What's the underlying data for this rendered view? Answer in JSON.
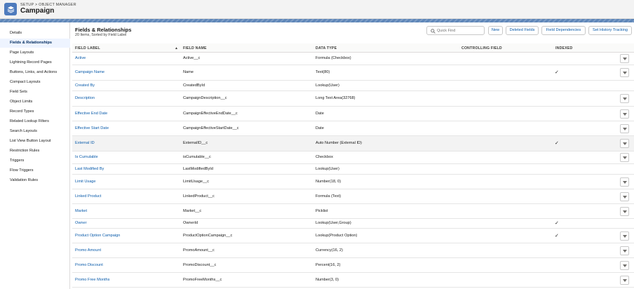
{
  "header": {
    "breadcrumb": "SETUP > OBJECT MANAGER",
    "title": "Campaign",
    "icon": "layers-icon"
  },
  "sidebar": {
    "items": [
      {
        "label": "Details"
      },
      {
        "label": "Fields & Relationships",
        "active": true
      },
      {
        "label": "Page Layouts"
      },
      {
        "label": "Lightning Record Pages"
      },
      {
        "label": "Buttons, Links, and Actions"
      },
      {
        "label": "Compact Layouts"
      },
      {
        "label": "Field Sets"
      },
      {
        "label": "Object Limits"
      },
      {
        "label": "Record Types"
      },
      {
        "label": "Related Lookup Filters"
      },
      {
        "label": "Search Layouts"
      },
      {
        "label": "List View Button Layout"
      },
      {
        "label": "Restriction Rules"
      },
      {
        "label": "Triggers"
      },
      {
        "label": "Flow Triggers"
      },
      {
        "label": "Validation Rules"
      }
    ]
  },
  "main": {
    "title": "Fields & Relationships",
    "subtitle": "20 Items, Sorted by Field Label",
    "search_placeholder": "Quick Find",
    "buttons": {
      "new": "New",
      "deleted_fields": "Deleted Fields",
      "field_dependencies": "Field Dependencies",
      "set_history_tracking": "Set History Tracking"
    },
    "columns": {
      "field_label": "FIELD LABEL",
      "field_name": "FIELD NAME",
      "data_type": "DATA TYPE",
      "controlling_field": "CONTROLLING FIELD",
      "indexed": "INDEXED"
    },
    "sort_icon": "arrow-up-icon",
    "check_glyph": "✓",
    "rows": [
      {
        "label": "Active",
        "name": "Active__c",
        "type": "Formula (Checkbox)",
        "controlling": "",
        "indexed": false,
        "menu": true
      },
      {
        "label": "Campaign Name",
        "name": "Name",
        "type": "Text(80)",
        "controlling": "",
        "indexed": true,
        "menu": true
      },
      {
        "label": "Created By",
        "name": "CreatedById",
        "type": "Lookup(User)",
        "controlling": "",
        "indexed": false,
        "menu": false
      },
      {
        "label": "Description",
        "name": "CampaignDescription__c",
        "type": "Long Text Area(32768)",
        "controlling": "",
        "indexed": false,
        "menu": true
      },
      {
        "label": "Effective End Date",
        "name": "CampaignEffectiveEndDate__c",
        "type": "Date",
        "controlling": "",
        "indexed": false,
        "menu": true
      },
      {
        "label": "Effective Start Date",
        "name": "CampaignEffectiveStartDate__c",
        "type": "Date",
        "controlling": "",
        "indexed": false,
        "menu": true
      },
      {
        "label": "External ID",
        "name": "ExternalID__c",
        "type": "Auto Number (External ID)",
        "controlling": "",
        "indexed": true,
        "menu": true,
        "highlight": true
      },
      {
        "label": "Is Cumulable",
        "name": "isCumulable__c",
        "type": "Checkbox",
        "controlling": "",
        "indexed": false,
        "menu": true
      },
      {
        "label": "Last Modified By",
        "name": "LastModifiedById",
        "type": "Lookup(User)",
        "controlling": "",
        "indexed": false,
        "menu": false
      },
      {
        "label": "Limit Usage",
        "name": "LimitUsage__c",
        "type": "Number(18, 0)",
        "controlling": "",
        "indexed": false,
        "menu": true
      },
      {
        "label": "Linked Product",
        "name": "LinkedProduct__c",
        "type": "Formula (Text)",
        "controlling": "",
        "indexed": false,
        "menu": true
      },
      {
        "label": "Market",
        "name": "Market__c",
        "type": "Picklist",
        "controlling": "",
        "indexed": false,
        "menu": true
      },
      {
        "label": "Owner",
        "name": "OwnerId",
        "type": "Lookup(User,Group)",
        "controlling": "",
        "indexed": true,
        "menu": false
      },
      {
        "label": "Product Option Campaign",
        "name": "ProductOptionCampaign__c",
        "type": "Lookup(Product Option)",
        "controlling": "",
        "indexed": true,
        "menu": true
      },
      {
        "label": "Promo Amount",
        "name": "PromoAmount__c",
        "type": "Currency(16, 2)",
        "controlling": "",
        "indexed": false,
        "menu": true
      },
      {
        "label": "Promo Discount",
        "name": "PromoDiscount__c",
        "type": "Percent(16, 2)",
        "controlling": "",
        "indexed": false,
        "menu": true
      },
      {
        "label": "Promo Free Months",
        "name": "PromoFreeMonths__c",
        "type": "Number(3, 0)",
        "controlling": "",
        "indexed": false,
        "menu": true
      }
    ]
  }
}
